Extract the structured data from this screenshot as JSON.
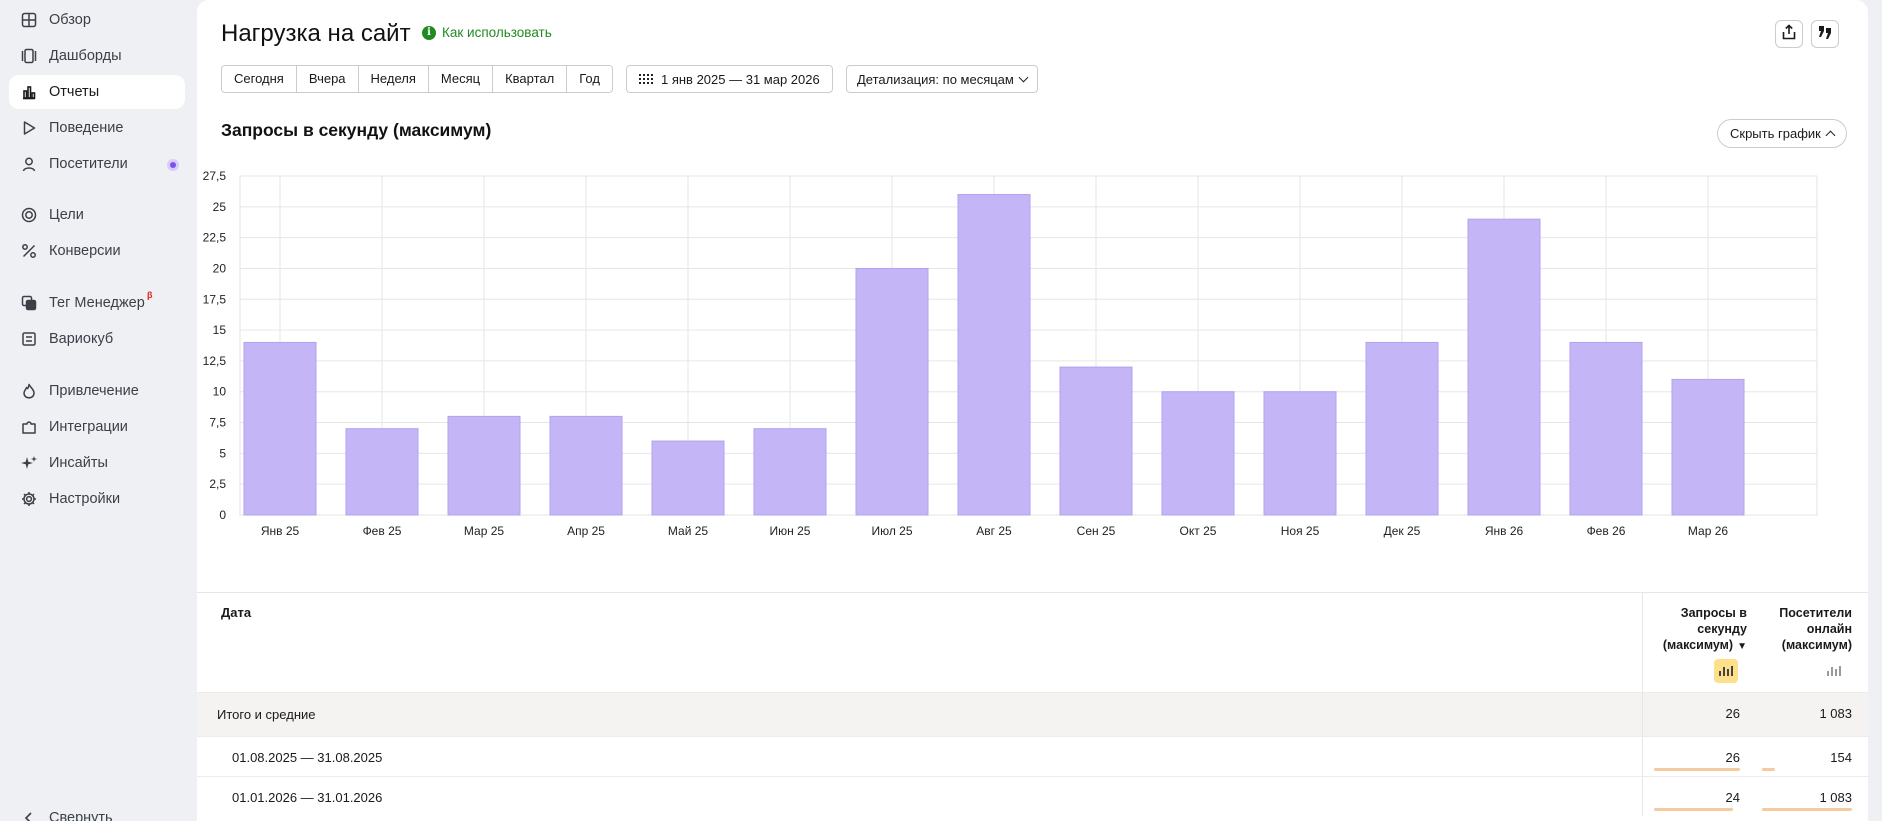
{
  "sidebar": {
    "items": [
      {
        "label": "Обзор",
        "icon": "grid-icon"
      },
      {
        "label": "Дашборды",
        "icon": "dashboards-icon"
      },
      {
        "label": "Отчеты",
        "icon": "bar-chart-icon",
        "active": true
      },
      {
        "label": "Поведение",
        "icon": "play-icon"
      },
      {
        "label": "Посетители",
        "icon": "person-icon",
        "has_dot": true
      },
      {
        "label": "Цели",
        "icon": "target-icon"
      },
      {
        "label": "Конверсии",
        "icon": "percent-icon"
      },
      {
        "label": "Тег Менеджер",
        "icon": "tag-manager-icon",
        "badge": "β"
      },
      {
        "label": "Вариокуб",
        "icon": "variocube-icon"
      },
      {
        "label": "Привлечение",
        "icon": "flame-icon"
      },
      {
        "label": "Интеграции",
        "icon": "puzzle-icon"
      },
      {
        "label": "Инсайты",
        "icon": "sparkle-icon"
      },
      {
        "label": "Настройки",
        "icon": "gear-icon"
      }
    ],
    "collapse_label": "Свернуть",
    "accent_color": "#7e4ff2"
  },
  "header": {
    "title": "Нагрузка на сайт",
    "howto_label": "Как использовать",
    "howto_icon": "info-icon"
  },
  "toolbar": {
    "periods": [
      "Сегодня",
      "Вчера",
      "Неделя",
      "Месяц",
      "Квартал",
      "Год"
    ],
    "date_range": "1 янв 2025 — 31 мар 2026",
    "detail_label": "Детализация: по месяцам",
    "export_icon": "share-icon",
    "compare_icon": "quote-icon"
  },
  "chart_section": {
    "title": "Запросы в секунду (максимум)",
    "hide_label": "Скрыть график"
  },
  "chart_data": {
    "type": "bar",
    "categories": [
      "Янв 25",
      "Фев 25",
      "Мар 25",
      "Апр 25",
      "Май 25",
      "Июн 25",
      "Июл 25",
      "Авг 25",
      "Сен 25",
      "Окт 25",
      "Ноя 25",
      "Дек 25",
      "Янв 26",
      "Фев 26",
      "Мар 26"
    ],
    "values": [
      14,
      7,
      8,
      8,
      6,
      7,
      20,
      26,
      12,
      10,
      10,
      14,
      24,
      14,
      11
    ],
    "ylim": [
      0,
      27.5
    ],
    "yticks": [
      "0",
      "2,5",
      "5",
      "7,5",
      "10",
      "12,5",
      "15",
      "17,5",
      "20",
      "22,5",
      "25",
      "27,5"
    ],
    "title": "",
    "xlabel": "",
    "ylabel": "",
    "grid": true,
    "bar_color": "#c4b5f7",
    "bar_stroke": "#b3a2f0"
  },
  "table": {
    "col_date": "Дата",
    "col_requests": "Запросы в секунду (максимум)",
    "col_requests_sort": "▼",
    "col_visitors": "Посетители онлайн (максимум)",
    "totals": {
      "label": "Итого и средние",
      "requests": "26",
      "visitors": "1 083"
    },
    "rows": [
      {
        "date": "01.08.2025 — 31.08.2025",
        "requests": "26",
        "visitors": "154",
        "requests_share": 1.0,
        "visitors_share": 0.14
      },
      {
        "date": "01.01.2026 — 31.01.2026",
        "requests": "24",
        "visitors": "1 083",
        "requests_share": 0.92,
        "visitors_share": 1.0
      }
    ],
    "bar_color": "#f6caa0",
    "toggle_on_color": "#ffe08a"
  }
}
